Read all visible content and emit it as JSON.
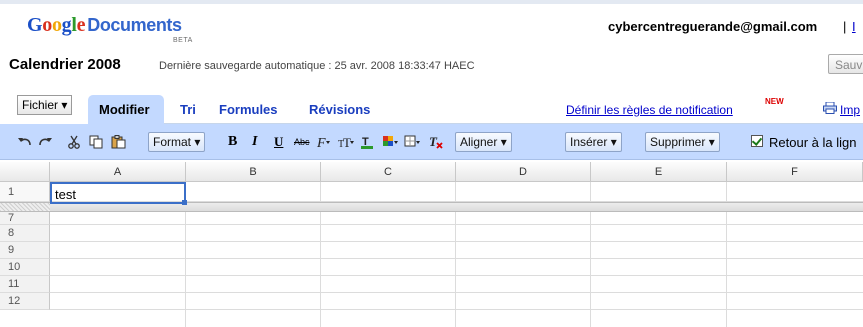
{
  "header": {
    "logo_letters": [
      "G",
      "o",
      "o",
      "g",
      "l",
      "e"
    ],
    "product": "Documents",
    "beta": "BETA",
    "account_email": "cybercentreguerande@gmail.com",
    "account_sep": "|",
    "account_link": "I"
  },
  "document": {
    "title": "Calendrier 2008",
    "autosave": "Dernière sauvegarde automatique : 25 avr. 2008 18:33:47 HAEC",
    "save_button": "Sauv"
  },
  "menubar": {
    "fichier_label": "Fichier",
    "tabs": [
      {
        "label": "Modifier",
        "active": true
      },
      {
        "label": "Tri",
        "active": false
      },
      {
        "label": "Formules",
        "active": false
      },
      {
        "label": "Révisions",
        "active": false
      }
    ],
    "notification_link": "Définir les règles de notification",
    "new_badge": "NEW",
    "print_link": "Imp"
  },
  "toolbar": {
    "format_label": "Format",
    "bold": "B",
    "italic": "I",
    "underline": "U",
    "strike": "Abc",
    "align_label": "Aligner",
    "insert_label": "Insérer",
    "delete_label": "Supprimer",
    "wrap_label": "Retour à la lign",
    "wrap_checked": true
  },
  "grid": {
    "columns": [
      "A",
      "B",
      "C",
      "D",
      "E",
      "F"
    ],
    "rows": [
      "1",
      "7",
      "8",
      "9",
      "10",
      "11",
      "12"
    ],
    "cell_A1": "test"
  },
  "colors": {
    "accent": "#c3d9ff",
    "link": "#0000cc",
    "tab_text": "#1a3ebf",
    "selection": "#3b6fc8"
  }
}
